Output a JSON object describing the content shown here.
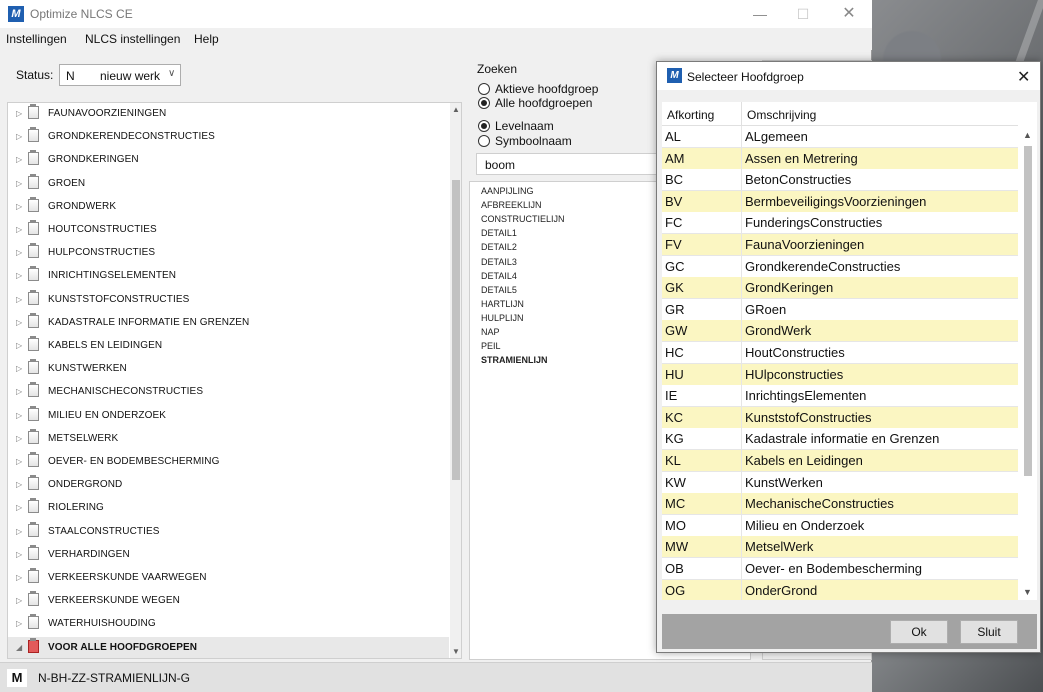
{
  "app": {
    "title": "Optimize NLCS CE",
    "icon": "app-logo-icon"
  },
  "menu": [
    "Instellingen",
    "NLCS instellingen",
    "Help"
  ],
  "status": {
    "label": "Status:",
    "code": "N",
    "value": "nieuw werk"
  },
  "tree": {
    "items": [
      "FAUNAVOORZIENINGEN",
      "GRONDKERENDECONSTRUCTIES",
      "GRONDKERINGEN",
      "GROEN",
      "GRONDWERK",
      "HOUTCONSTRUCTIES",
      "HULPCONSTRUCTIES",
      "INRICHTINGSELEMENTEN",
      "KUNSTSTOFCONSTRUCTIES",
      "KADASTRALE INFORMATIE EN GRENZEN",
      "KABELS EN LEIDINGEN",
      "KUNSTWERKEN",
      "MECHANISCHECONSTRUCTIES",
      "MILIEU EN ONDERZOEK",
      "METSELWERK",
      "OEVER- EN BODEMBESCHERMING",
      "ONDERGROND",
      "RIOLERING",
      "STAALCONSTRUCTIES",
      "VERHARDINGEN",
      "VERKEERSKUNDE VAARWEGEN",
      "VERKEERSKUNDE WEGEN",
      "WATERHUISHOUDING",
      "VOOR ALLE HOOFDGROEPEN"
    ],
    "selected": "VOOR ALLE HOOFDGROEPEN"
  },
  "search": {
    "title": "Zoeken",
    "radio_group": [
      "Aktieve hoofdgroep",
      "Alle hoofdgroepen"
    ],
    "radio_name": [
      "Levelnaam",
      "Symboolnaam"
    ],
    "value": "boom"
  },
  "levels": [
    "AANPIJLING",
    "AFBREEKLIJN",
    "CONSTRUCTIELIJN",
    "DETAIL1",
    "DETAIL2",
    "DETAIL3",
    "DETAIL4",
    "DETAIL5",
    "HARTLIJN",
    "HULPLIJN",
    "NAP",
    "PEIL",
    "STRAMIENLIJN"
  ],
  "statusbar": {
    "mode": "M",
    "level": "N-BH-ZZ-STRAMIENLIJN-G"
  },
  "dialog": {
    "title": "Selecteer Hoofdgroep",
    "columns": [
      "Afkorting",
      "Omschrijving"
    ],
    "rows": [
      [
        "AL",
        "ALgemeen"
      ],
      [
        "AM",
        "Assen en Metrering"
      ],
      [
        "BC",
        "BetonConstructies"
      ],
      [
        "BV",
        "BermbeveiligingsVoorzieningen"
      ],
      [
        "FC",
        "FunderingsConstructies"
      ],
      [
        "FV",
        "FaunaVoorzieningen"
      ],
      [
        "GC",
        "GrondkerendeConstructies"
      ],
      [
        "GK",
        "GrondKeringen"
      ],
      [
        "GR",
        "GRoen"
      ],
      [
        "GW",
        "GrondWerk"
      ],
      [
        "HC",
        "HoutConstructies"
      ],
      [
        "HU",
        "HUlpconstructies"
      ],
      [
        "IE",
        "InrichtingsElementen"
      ],
      [
        "KC",
        "KunststofConstructies"
      ],
      [
        "KG",
        "Kadastrale informatie en Grenzen"
      ],
      [
        "KL",
        "Kabels en Leidingen"
      ],
      [
        "KW",
        "KunstWerken"
      ],
      [
        "MC",
        "MechanischeConstructies"
      ],
      [
        "MO",
        "Milieu en Onderzoek"
      ],
      [
        "MW",
        "MetselWerk"
      ],
      [
        "OB",
        "Oever- en Bodembescherming"
      ],
      [
        "OG",
        "OnderGrond"
      ]
    ],
    "ok_label": "Ok",
    "close_label": "Sluit"
  },
  "colors": {
    "row_alt": "#fbf6c2",
    "accent": "#1f5fb0"
  }
}
